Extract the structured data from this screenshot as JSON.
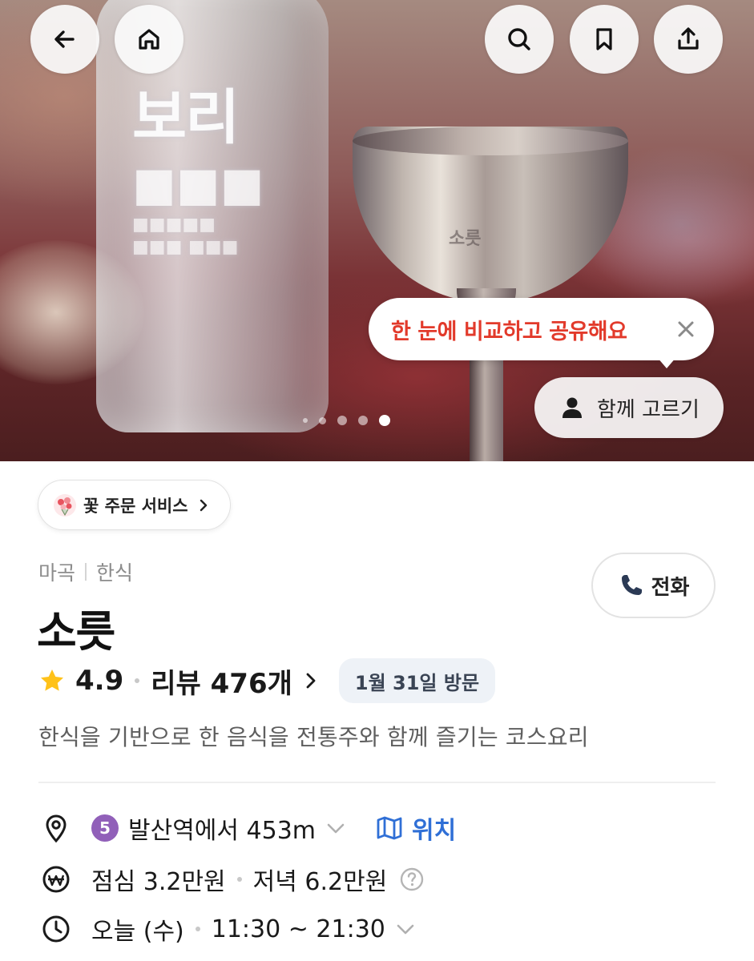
{
  "header": {
    "back_icon": "back-arrow-icon",
    "home_icon": "home-icon",
    "search_icon": "search-icon",
    "bookmark_icon": "bookmark-icon",
    "share_icon": "share-icon"
  },
  "hero": {
    "tooltip_text": "한 눈에 비교하고 공유해요",
    "together_label": "함께 고르기",
    "carousel": {
      "total": 5,
      "active_index": 4
    },
    "colors": {
      "tooltip_text": "#e23a2b"
    }
  },
  "flower_service": {
    "label": "꽃 주문 서비스"
  },
  "place": {
    "area": "마곡",
    "category": "한식",
    "name": "소릇",
    "call_label": "전화",
    "rating": "4.9",
    "reviews": "리뷰 476개",
    "visit_badge": "1월 31일 방문",
    "description": "한식을 기반으로 한 음식을 전통주와 함께 즐기는 코스요리"
  },
  "location": {
    "subway_line": "5",
    "subway_line_color": "#9160b9",
    "distance_text": "발산역에서 453m",
    "map_label": "위치",
    "map_color": "#2f6fd6"
  },
  "price": {
    "lunch": "점심 3.2만원",
    "dinner": "저녁 6.2만원"
  },
  "hours": {
    "day": "오늘 (수)",
    "time": "11:30 ~ 21:30"
  }
}
